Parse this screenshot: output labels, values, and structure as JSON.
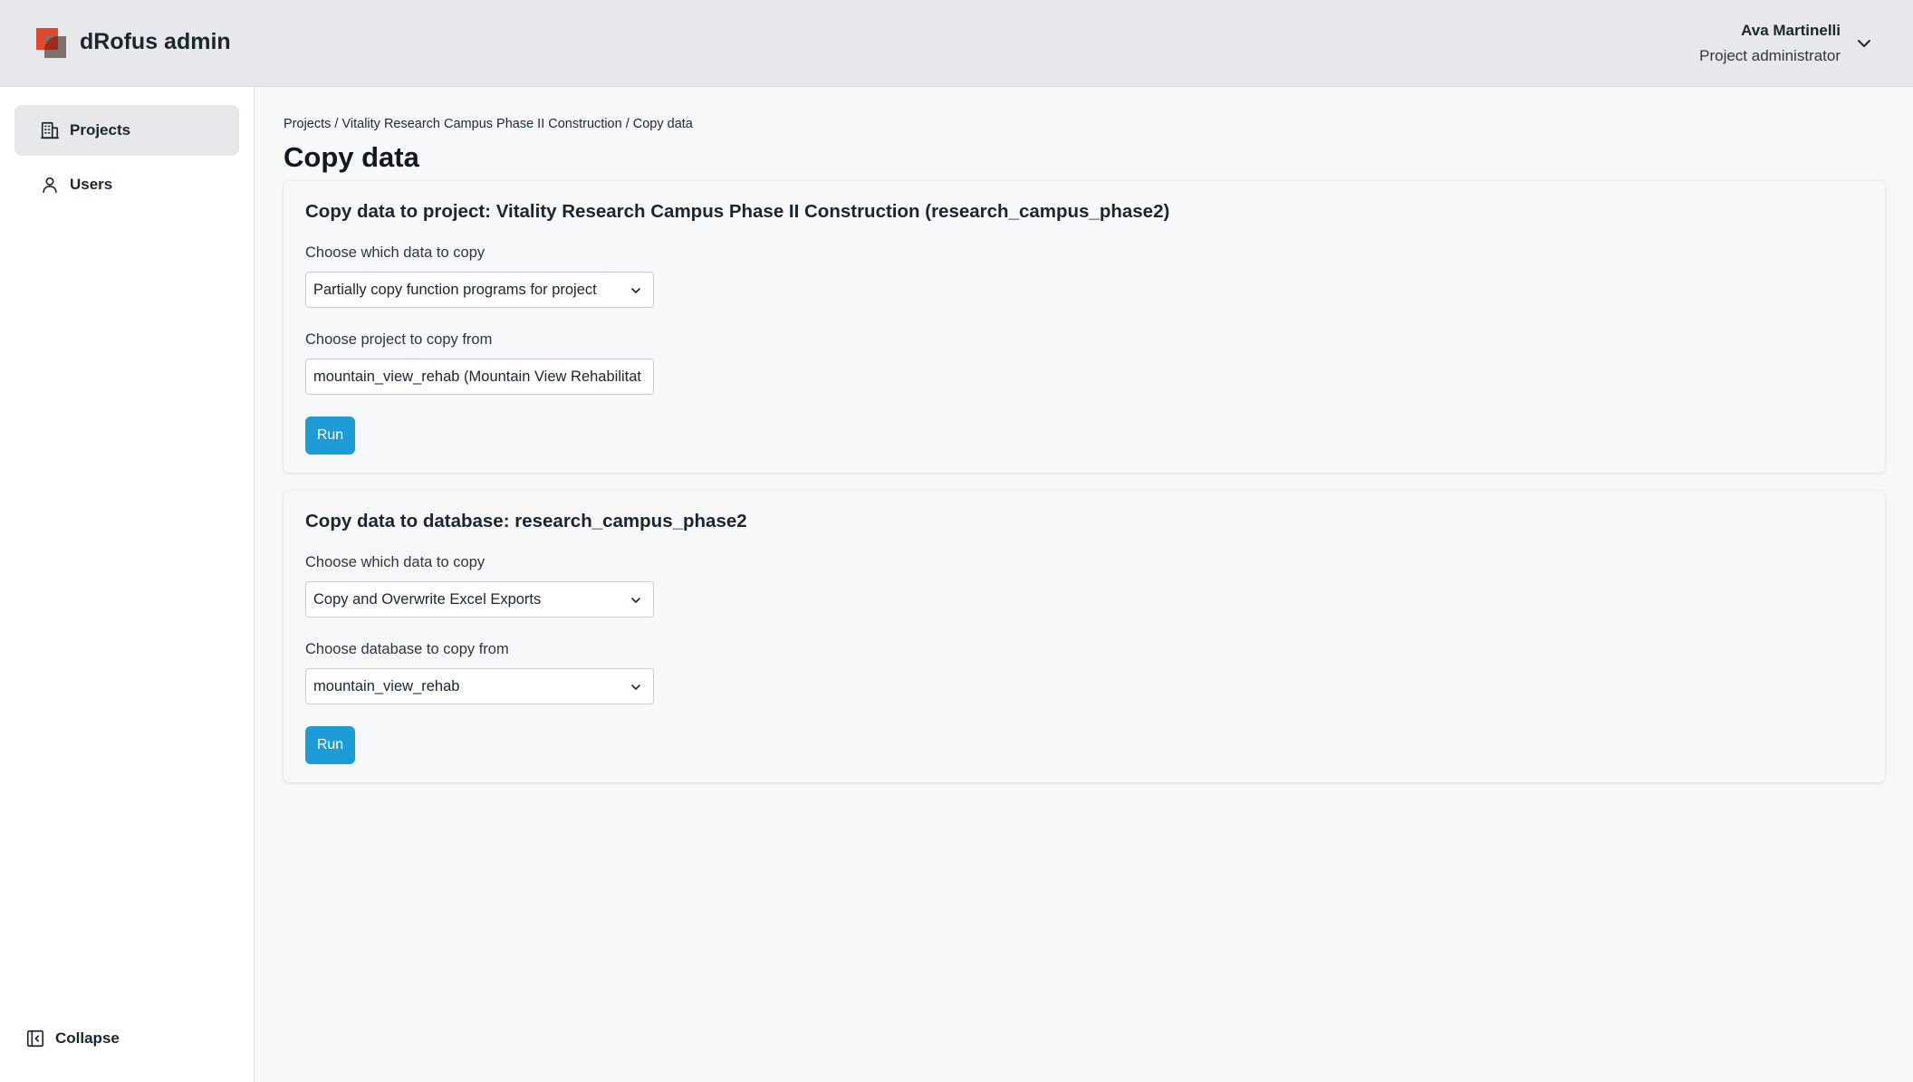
{
  "header": {
    "app_title": "dRofus admin",
    "user_name": "Ava Martinelli",
    "user_role": "Project administrator"
  },
  "sidebar": {
    "items": [
      {
        "label": "Projects",
        "icon": "building-icon",
        "active": true
      },
      {
        "label": "Users",
        "icon": "user-icon",
        "active": false
      }
    ],
    "collapse_label": "Collapse"
  },
  "main": {
    "breadcrumb": "Projects / Vitality Research Campus Phase II Construction / Copy data",
    "page_title": "Copy data",
    "project_card": {
      "title": "Copy data to project: Vitality Research Campus Phase II Construction (research_campus_phase2)",
      "data_label": "Choose which data to copy",
      "data_value": "Partially copy function programs for project",
      "source_label": "Choose project to copy from",
      "source_value": "mountain_view_rehab (Mountain View Rehabilitat",
      "run_label": "Run"
    },
    "database_card": {
      "title": "Copy data to database: research_campus_phase2",
      "data_label": "Choose which data to copy",
      "data_value": "Copy and Overwrite Excel Exports",
      "source_label": "Choose database to copy from",
      "source_value": "mountain_view_rehab",
      "run_label": "Run"
    }
  },
  "colors": {
    "accent": "#1d9bd6",
    "header_bg": "#e6e8eb",
    "logo_red": "#e0492c",
    "logo_gray": "#7d736e"
  }
}
